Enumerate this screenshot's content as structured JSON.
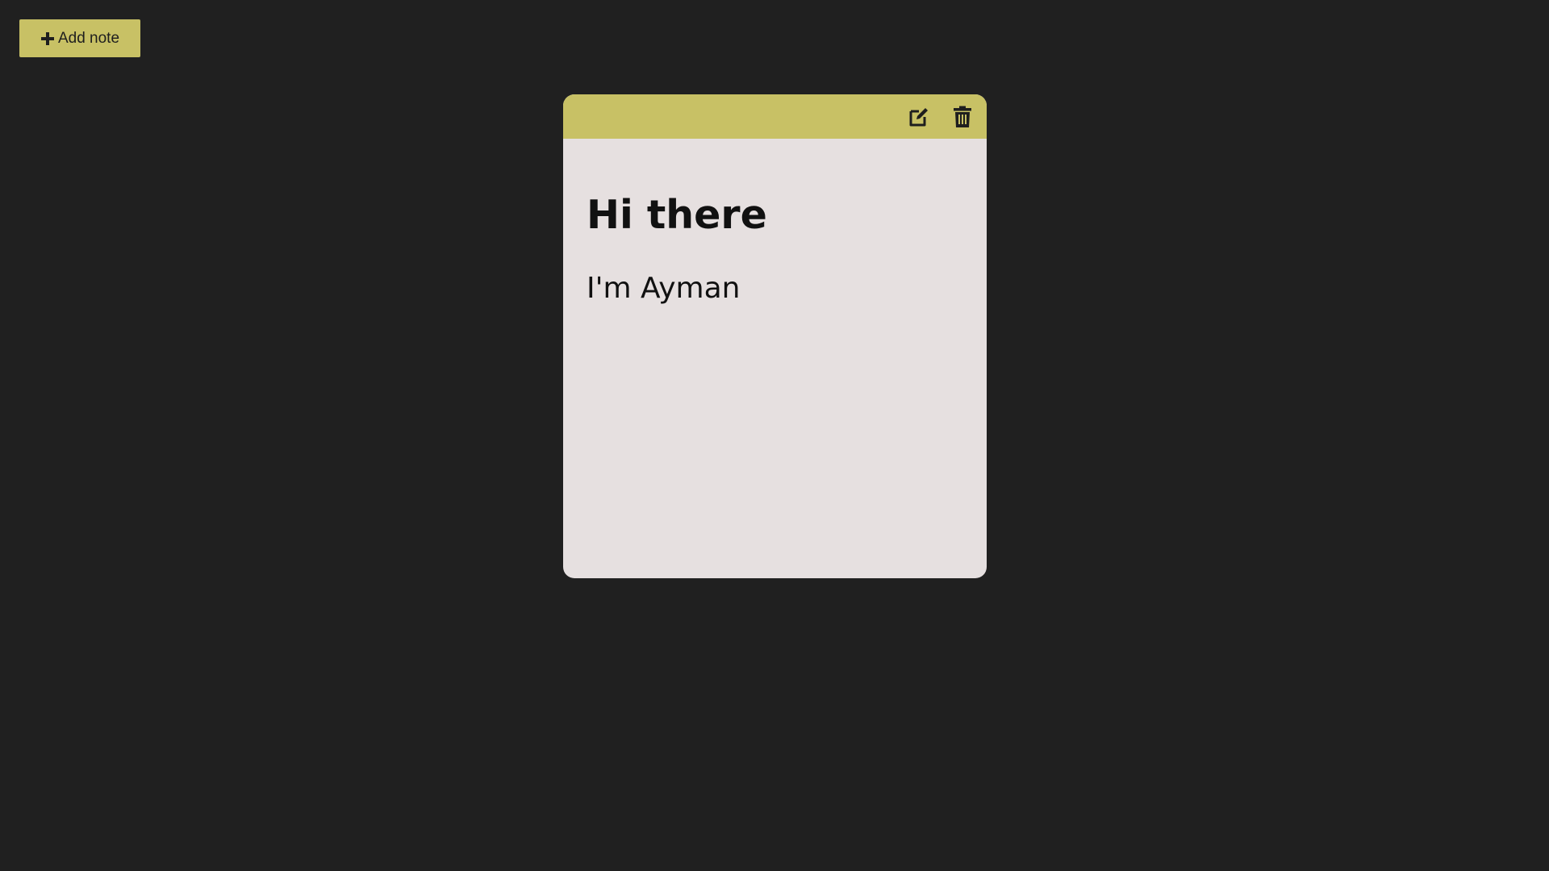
{
  "toolbar": {
    "add_label": "Add note",
    "add_icon": "plus-icon"
  },
  "note": {
    "title": "Hi there",
    "body": "I'm Ayman",
    "edit_icon": "edit-icon",
    "delete_icon": "trash-icon"
  },
  "colors": {
    "background": "#202020",
    "accent": "#c8c165",
    "note_body": "#e6e0e0",
    "text": "#111111"
  }
}
